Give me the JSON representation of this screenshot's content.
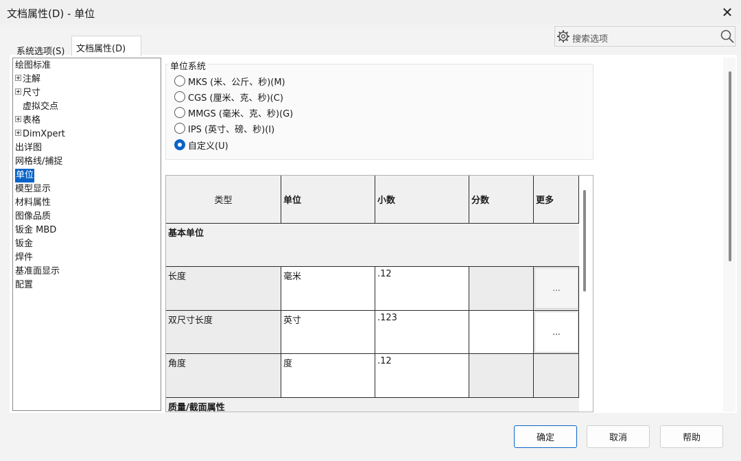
{
  "window": {
    "title": "文档属性(D) - 单位",
    "close_glyph": "✕"
  },
  "tabs": [
    {
      "label": "系统选项(S)"
    },
    {
      "label": "文档属性(D)"
    }
  ],
  "search": {
    "placeholder": "搜索选项",
    "icon_left": "gear-icon",
    "icon_right": "search-icon"
  },
  "tree": {
    "items": [
      {
        "label": "绘图标准"
      },
      {
        "label": "注解",
        "expandable": true
      },
      {
        "label": "尺寸",
        "expandable": true
      },
      {
        "label": "虚拟交点"
      },
      {
        "label": "表格",
        "expandable": true
      },
      {
        "label": "DimXpert",
        "expandable": true
      },
      {
        "label": "出详图"
      },
      {
        "label": "网格线/捕捉"
      },
      {
        "label": "单位",
        "selected": true
      },
      {
        "label": "模型显示"
      },
      {
        "label": "材料属性"
      },
      {
        "label": "图像品质"
      },
      {
        "label": "钣金 MBD"
      },
      {
        "label": "钣金"
      },
      {
        "label": "焊件"
      },
      {
        "label": "基准面显示"
      },
      {
        "label": "配置"
      }
    ]
  },
  "unit_system": {
    "title": "单位系统",
    "options": [
      {
        "label": "MKS (米、公斤、秒)(M)",
        "selected": false
      },
      {
        "label": "CGS (厘米、克、秒)(C)",
        "selected": false
      },
      {
        "label": "MMGS (毫米、克、秒)(G)",
        "selected": false
      },
      {
        "label": "IPS (英寸、磅、秒)(I)",
        "selected": false
      },
      {
        "label": "自定义(U)",
        "selected": true
      }
    ]
  },
  "table": {
    "headers": {
      "type": "类型",
      "unit": "单位",
      "decimals": "小数",
      "fractions": "分数",
      "more": "更多"
    },
    "sections": {
      "basic": "基本单位",
      "mass": "质量/截面属性"
    },
    "rows": [
      {
        "type": "长度",
        "unit": "毫米",
        "decimals": ".12",
        "more": "..."
      },
      {
        "type": "双尺寸长度",
        "unit": "英寸",
        "decimals": ".123",
        "more": "..."
      },
      {
        "type": "角度",
        "unit": "度",
        "decimals": ".12",
        "more": ""
      }
    ]
  },
  "buttons": {
    "ok": "确定",
    "cancel": "取消",
    "help": "帮助"
  },
  "colors": {
    "accent": "#0a64c8",
    "panel": "#ffffff",
    "chrome": "#f3f3f3"
  }
}
